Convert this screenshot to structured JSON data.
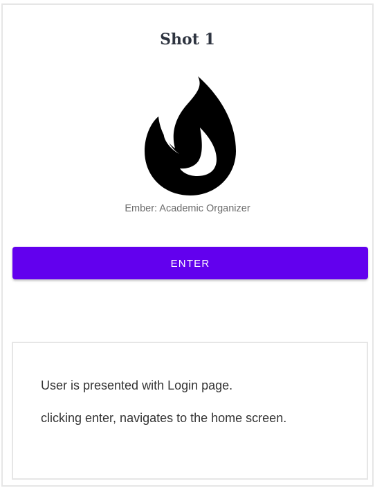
{
  "shot": {
    "title": "Shot 1"
  },
  "logo": {
    "icon": "flame-icon",
    "color": "#000000"
  },
  "app": {
    "name": "Ember: Academic Organizer"
  },
  "login": {
    "enter_label": "ENTER",
    "button_color": "#6200ee"
  },
  "notes": {
    "line1": "User is presented with Login page.",
    "line2": "clicking enter, navigates to the home screen."
  }
}
